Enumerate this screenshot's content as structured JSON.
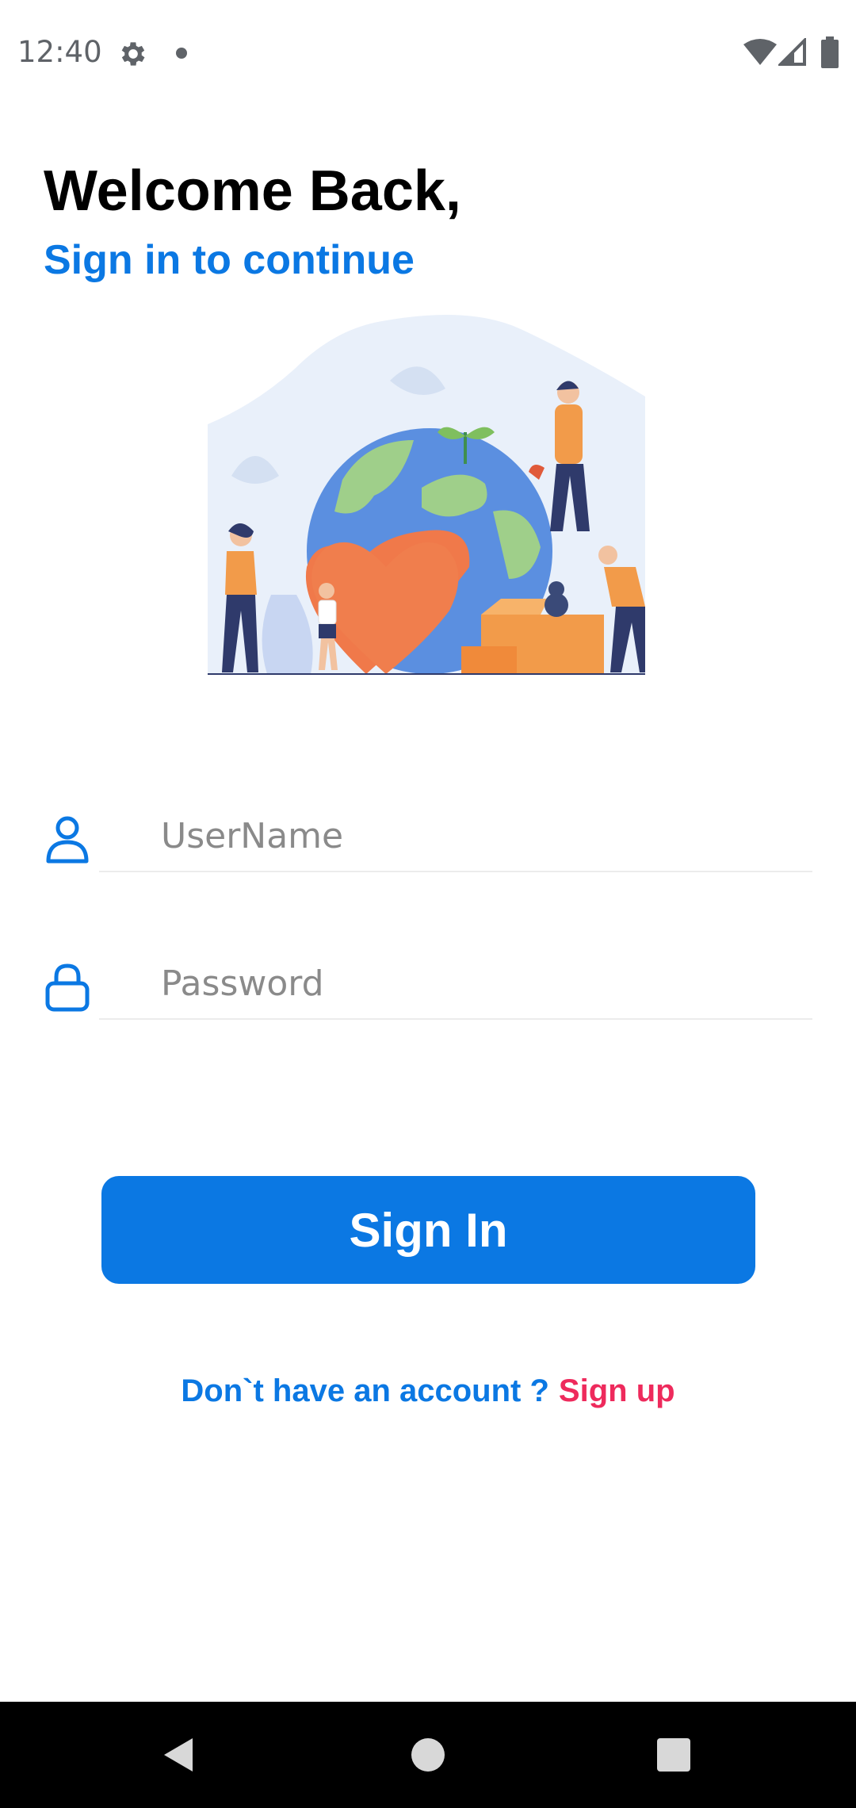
{
  "colors": {
    "accent": "#0b78e3",
    "link": "#ee2a5c",
    "text_primary": "#000000",
    "status_gray": "#5f6368"
  },
  "status_bar": {
    "time": "12:40",
    "icons": [
      "gear-icon",
      "notification-dot-icon",
      "wifi-icon",
      "cell-signal-icon",
      "battery-icon"
    ]
  },
  "header": {
    "title": "Welcome Back,",
    "subtitle": "Sign in to continue"
  },
  "illustration": {
    "icon": "earth-heart-volunteers-illustration"
  },
  "form": {
    "username": {
      "placeholder": "UserName",
      "value": "",
      "icon": "user-icon"
    },
    "password": {
      "placeholder": "Password",
      "value": "",
      "icon": "lock-icon"
    },
    "submit_label": "Sign In"
  },
  "footer": {
    "prompt": "Don`t have an account ?",
    "signup_label": "Sign up"
  },
  "nav_bar": {
    "icons": [
      "back-icon",
      "home-icon",
      "recents-icon"
    ]
  }
}
